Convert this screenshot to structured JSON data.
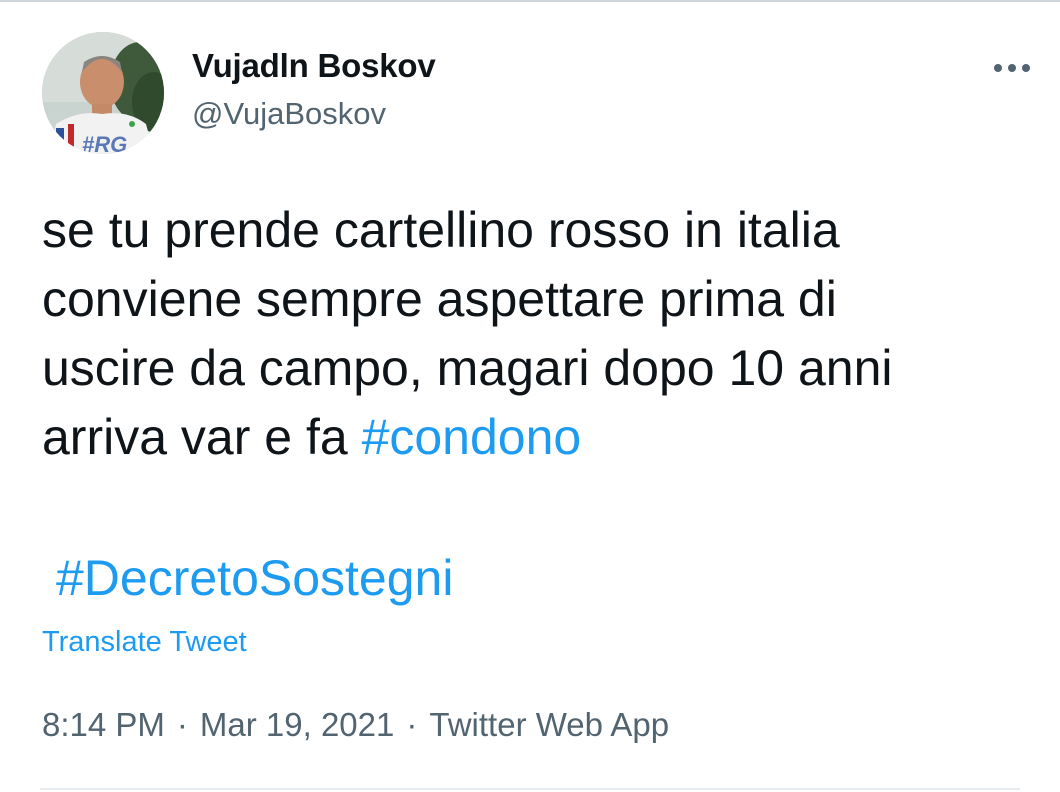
{
  "tweet": {
    "author": {
      "display_name": "Vujadln Boskov",
      "handle": "@VujaBoskov",
      "avatar_badge_text": "#RG"
    },
    "text_lines": [
      "se tu prende cartellino rosso in italia",
      "conviene sempre aspettare prima di",
      "uscire da campo, magari dopo 10 anni",
      "arriva var e fa "
    ],
    "inline_hashtag": "#condono",
    "standalone_hashtag": "#DecretoSostegni",
    "translate_label": "Translate Tweet",
    "meta": {
      "time": "8:14 PM",
      "separator": "·",
      "date": "Mar 19, 2021",
      "source": "Twitter Web App"
    }
  },
  "icons": {
    "more": "more-horizontal-icon"
  },
  "colors": {
    "link": "#1d9bf0",
    "secondary_text": "#536471",
    "primary_text": "#0f1419"
  }
}
